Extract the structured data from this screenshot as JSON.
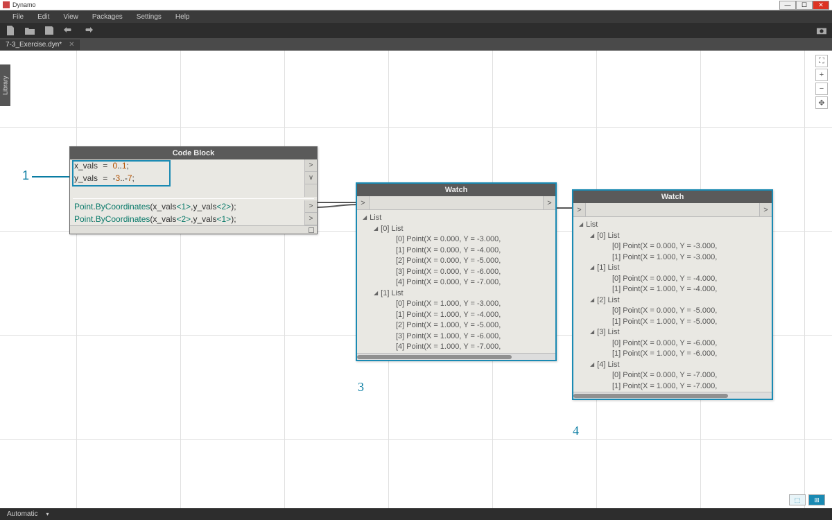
{
  "app": {
    "title": "Dynamo"
  },
  "menu": {
    "file": "File",
    "edit": "Edit",
    "view": "View",
    "packages": "Packages",
    "settings": "Settings",
    "help": "Help"
  },
  "tab": {
    "name": "7-3_Exercise.dyn*"
  },
  "sidebar": {
    "library": "Library"
  },
  "codeblock": {
    "title": "Code Block",
    "line1_raw": "x_vals = 0..1;",
    "line2_raw": "y_vals = -3..-7;",
    "line3_raw": "Point.ByCoordinates(x_vals<1>,y_vals<2>);",
    "line4_raw": "Point.ByCoordinates(x_vals<2>,y_vals<1>);"
  },
  "watch1": {
    "title": "Watch",
    "root": "List",
    "groups": [
      {
        "label": "[0] List",
        "items": [
          "[0] Point(X = 0.000, Y = -3.000,",
          "[1] Point(X = 0.000, Y = -4.000,",
          "[2] Point(X = 0.000, Y = -5.000,",
          "[3] Point(X = 0.000, Y = -6.000,",
          "[4] Point(X = 0.000, Y = -7.000,"
        ]
      },
      {
        "label": "[1] List",
        "items": [
          "[0] Point(X = 1.000, Y = -3.000,",
          "[1] Point(X = 1.000, Y = -4.000,",
          "[2] Point(X = 1.000, Y = -5.000,",
          "[3] Point(X = 1.000, Y = -6.000,",
          "[4] Point(X = 1.000, Y = -7.000,"
        ]
      }
    ]
  },
  "watch2": {
    "title": "Watch",
    "root": "List",
    "groups": [
      {
        "label": "[0] List",
        "items": [
          "[0] Point(X = 0.000, Y = -3.000,",
          "[1] Point(X = 1.000, Y = -3.000,"
        ]
      },
      {
        "label": "[1] List",
        "items": [
          "[0] Point(X = 0.000, Y = -4.000,",
          "[1] Point(X = 1.000, Y = -4.000,"
        ]
      },
      {
        "label": "[2] List",
        "items": [
          "[0] Point(X = 0.000, Y = -5.000,",
          "[1] Point(X = 1.000, Y = -5.000,"
        ]
      },
      {
        "label": "[3] List",
        "items": [
          "[0] Point(X = 0.000, Y = -6.000,",
          "[1] Point(X = 1.000, Y = -6.000,"
        ]
      },
      {
        "label": "[4] List",
        "items": [
          "[0] Point(X = 0.000, Y = -7.000,",
          "[1] Point(X = 1.000, Y = -7.000,"
        ]
      }
    ]
  },
  "annotations": {
    "a1": "1",
    "a3": "3",
    "a4": "4"
  },
  "statusbar": {
    "mode": "Automatic"
  }
}
